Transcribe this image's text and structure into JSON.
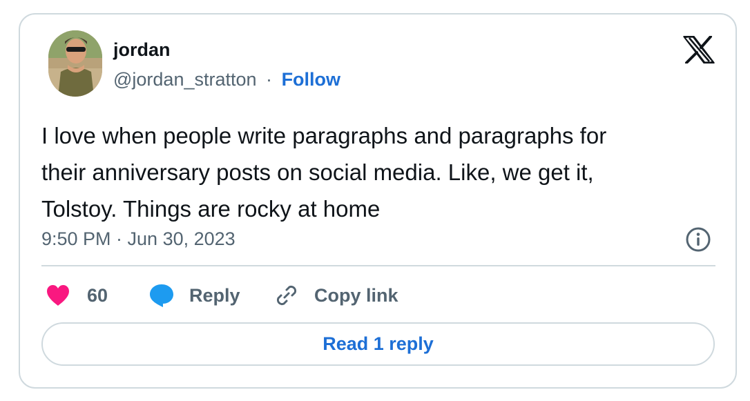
{
  "author": {
    "display_name": "jordan",
    "handle": "@jordan_stratton",
    "separator": "·",
    "follow_label": "Follow"
  },
  "tweet": {
    "lines": [
      "I love when people write paragraphs and paragraphs for",
      "their anniversary posts on social media. Like, we get it,",
      "Tolstoy. Things are rocky at home"
    ],
    "timestamp": "9:50 PM · Jun 30, 2023"
  },
  "actions": {
    "like_count": "60",
    "reply_label": "Reply",
    "copy_link_label": "Copy link"
  },
  "read_replies_label": "Read 1 reply",
  "icons": {
    "brand": "x-logo-icon",
    "like": "heart-icon",
    "reply": "speech-bubble-icon",
    "copy": "link-icon",
    "info": "info-icon"
  },
  "colors": {
    "text_primary": "#0f1419",
    "text_secondary": "#536471",
    "accent_blue": "#1d6fd6",
    "like_pink": "#f91880",
    "reply_blue": "#1d9bf0",
    "border": "#cfd9de"
  }
}
